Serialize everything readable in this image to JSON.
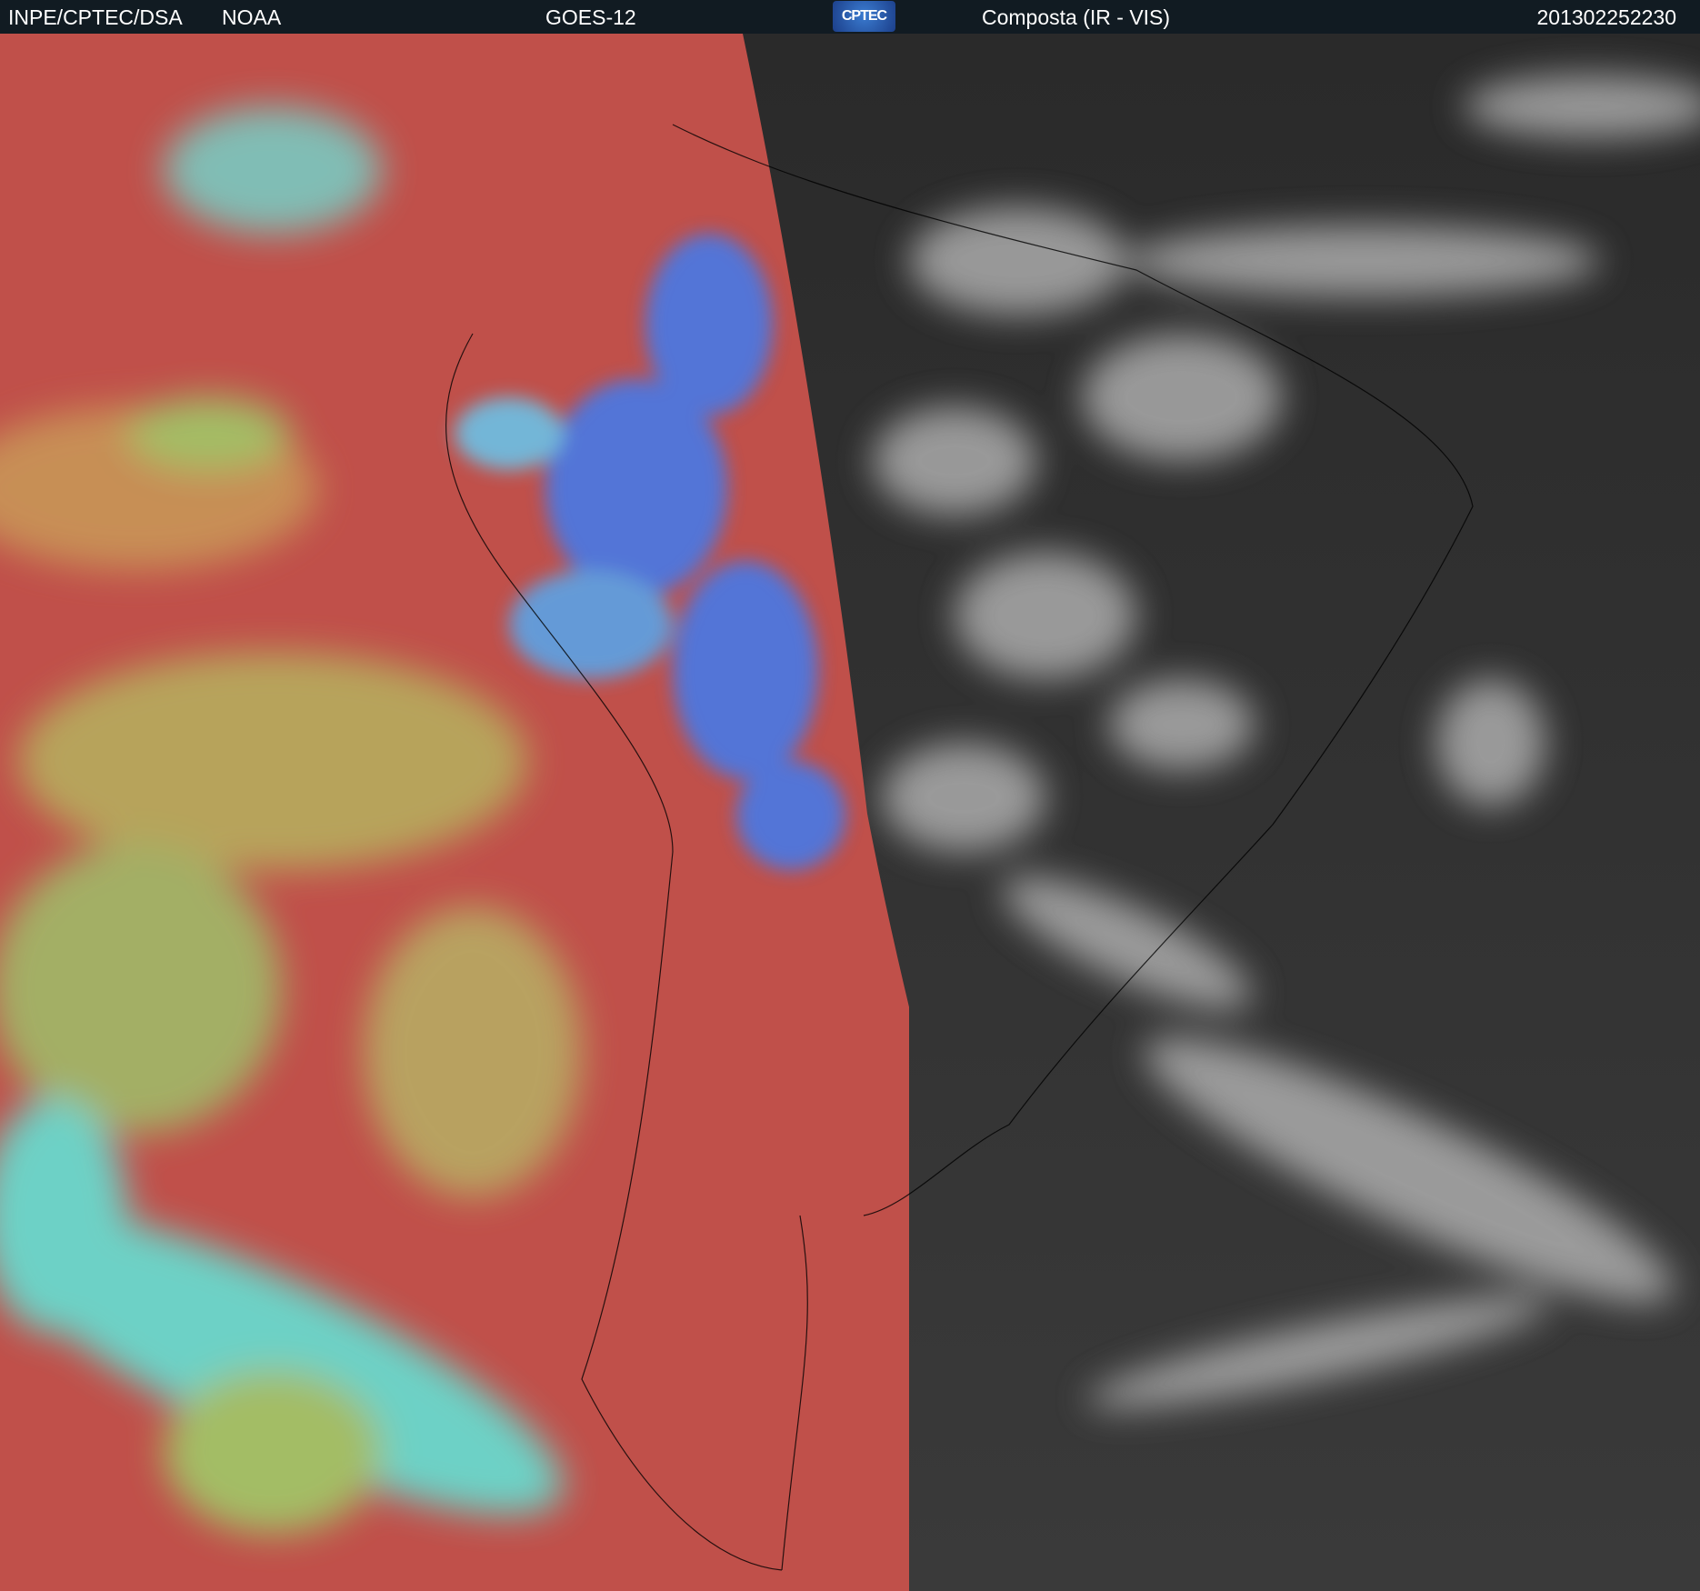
{
  "header": {
    "org": "INPE/CPTEC/DSA",
    "agency": "NOAA",
    "satellite": "GOES-12",
    "logo_text": "CPTEC",
    "product": "Composta (IR - VIS)",
    "timestamp": "201302252230"
  },
  "colors": {
    "header_bg": "#111b22",
    "ir_base": "#c0504a",
    "ir_cloud_green": "#9fd06a",
    "ir_cloud_cyan": "#5ee8dc",
    "ir_cloud_blue": "#3f7cf0",
    "vis_base": "#2c2c2c",
    "vis_cloud": "#cfcfcf"
  }
}
